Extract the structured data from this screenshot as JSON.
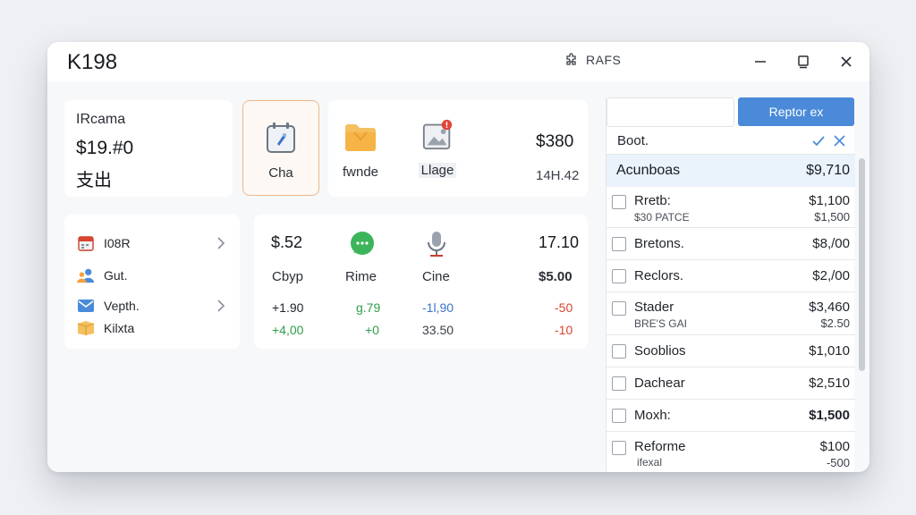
{
  "window": {
    "title": "K198"
  },
  "titlebar": {
    "center_label": "RAFS",
    "center_icon": "puzzle-icon"
  },
  "income": {
    "label": "IRcama",
    "value": "$19.#0",
    "sub": "支出"
  },
  "tiles": [
    {
      "label": "Cha",
      "icon": "calendar-rocket-icon"
    },
    {
      "label": "fwnde",
      "icon": "folder-icon"
    },
    {
      "label": "Llage",
      "icon": "image-notification-icon"
    }
  ],
  "top_stat": {
    "value": "$380",
    "sub": "14H.42"
  },
  "left_list": [
    {
      "label": "I08R",
      "icon": "calendar-icon"
    },
    {
      "label": "Gut.",
      "icon": "users-icon"
    },
    {
      "label": "Vepth.",
      "icon": "mail-icon"
    },
    {
      "label": "Kilxta",
      "icon": "box-icon"
    }
  ],
  "metrics": {
    "columns": [
      {
        "head": "$.52",
        "label": "Cbyp",
        "values": [
          "+1.90",
          "+4,00"
        ]
      },
      {
        "icon": "chat-bubble-icon",
        "label": "Rime",
        "values": [
          "g.79",
          "+0"
        ]
      },
      {
        "icon": "microphone-icon",
        "label": "Cine",
        "values": [
          "-1l,90",
          "33.50"
        ]
      },
      {
        "head": "17.10",
        "label": "$5.00",
        "values": [
          "-50",
          "-10"
        ]
      }
    ]
  },
  "colors": {
    "accent": "#4a8ad9",
    "green": "#2e9d4a",
    "blue": "#3a74c9",
    "red": "#d9452f"
  },
  "right_panel": {
    "primary_button": "Reptor ex",
    "filter_label": "Boot.",
    "selected": {
      "name": "Acunboas",
      "value": "$9,710"
    },
    "rows": [
      {
        "name": "Rretb:",
        "value": "$1,100",
        "sub": "$30 PATCE",
        "sub_value": "$1,500"
      },
      {
        "name": "Bretons.",
        "value": "$8,/00"
      },
      {
        "name": "Reclors.",
        "value": "$2,/00"
      },
      {
        "name": "Stader",
        "value": "$3,460",
        "sub": "BRE'S GAI",
        "sub_value": "$2.50"
      },
      {
        "name": "Sooblios",
        "value": "$1,010"
      },
      {
        "name": "Dachear",
        "value": "$2,510"
      },
      {
        "name": "Moxh:",
        "value": "$1,500",
        "bold": true
      },
      {
        "name": "Reforme",
        "value": "$100",
        "sub": "ifexal",
        "sub_value": "-500"
      }
    ]
  }
}
